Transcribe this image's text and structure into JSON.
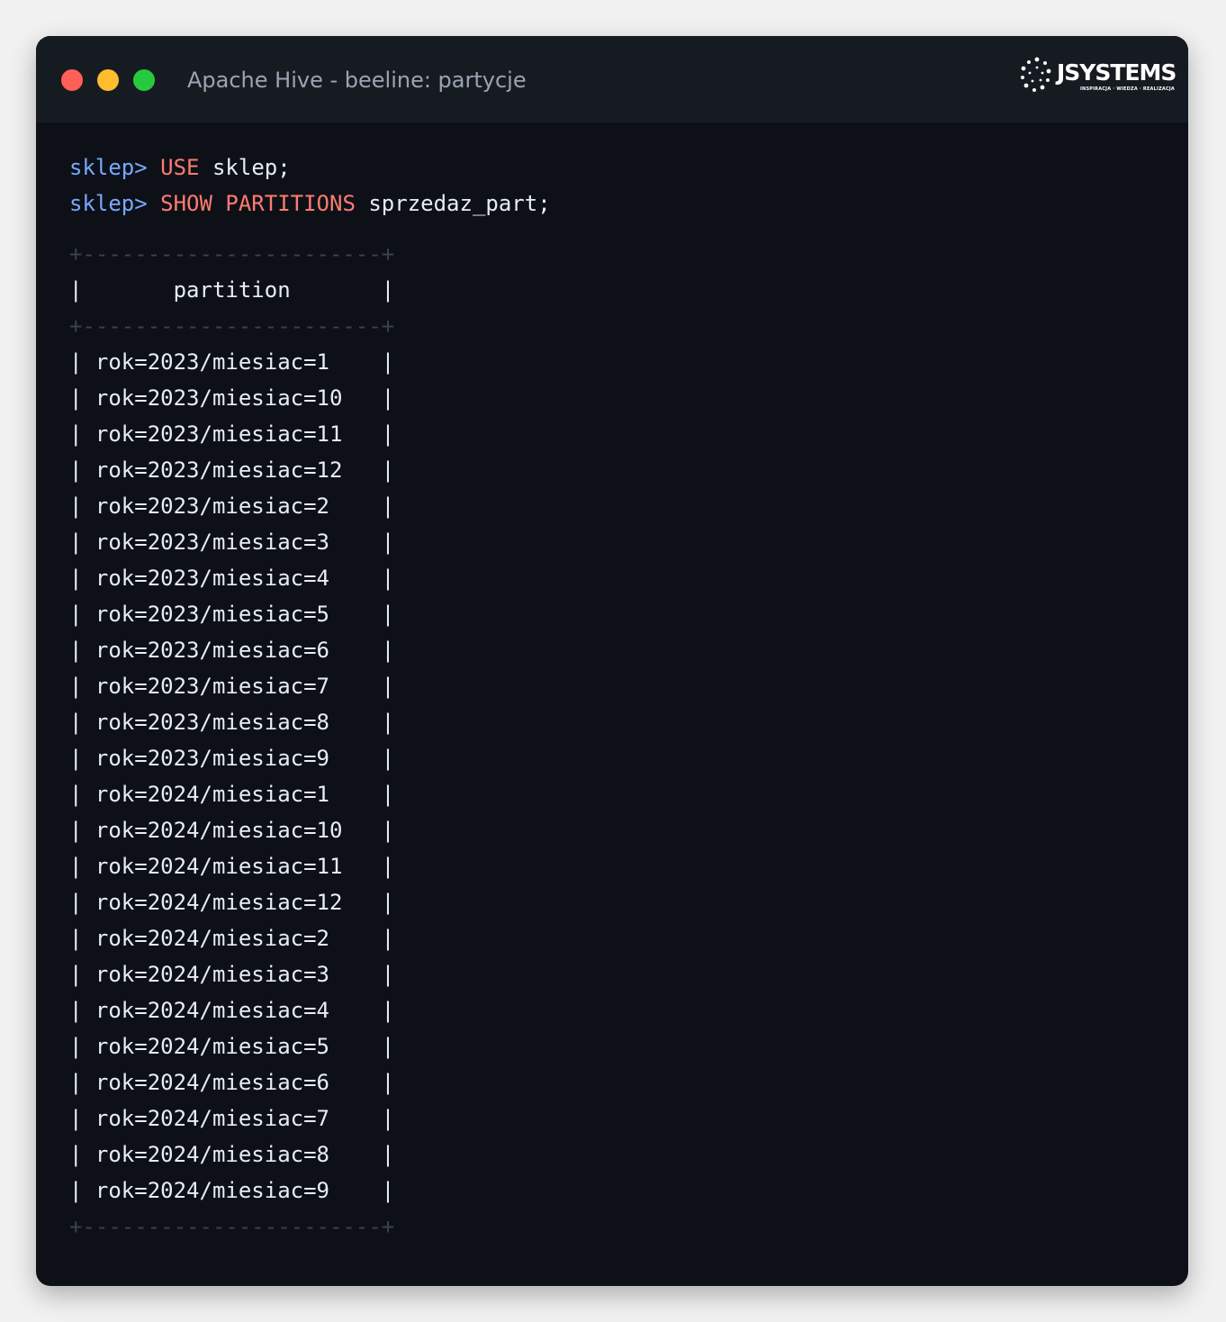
{
  "window": {
    "title": "Apache Hive - beeline: partycje",
    "logo": {
      "word": "JSYSTEMS",
      "tagline": "INSPIRACJA · WIEDZA · REALIZACJA"
    },
    "controls": {
      "close_color": "#ff5f56",
      "minimize_color": "#ffbd2e",
      "maximize_color": "#27c93f"
    }
  },
  "terminal": {
    "commands": [
      {
        "prompt": "sklep>",
        "keyword": "USE",
        "rest": "sklep;"
      },
      {
        "prompt": "sklep>",
        "keyword": "SHOW PARTITIONS",
        "rest": "sprzedaz_part;"
      }
    ],
    "table": {
      "border": "+-----------------------+",
      "header": "|       partition       |",
      "rows": [
        "| rok=2023/miesiac=1    |",
        "| rok=2023/miesiac=10   |",
        "| rok=2023/miesiac=11   |",
        "| rok=2023/miesiac=12   |",
        "| rok=2023/miesiac=2    |",
        "| rok=2023/miesiac=3    |",
        "| rok=2023/miesiac=4    |",
        "| rok=2023/miesiac=5    |",
        "| rok=2023/miesiac=6    |",
        "| rok=2023/miesiac=7    |",
        "| rok=2023/miesiac=8    |",
        "| rok=2023/miesiac=9    |",
        "| rok=2024/miesiac=1    |",
        "| rok=2024/miesiac=10   |",
        "| rok=2024/miesiac=11   |",
        "| rok=2024/miesiac=12   |",
        "| rok=2024/miesiac=2    |",
        "| rok=2024/miesiac=3    |",
        "| rok=2024/miesiac=4    |",
        "| rok=2024/miesiac=5    |",
        "| rok=2024/miesiac=6    |",
        "| rok=2024/miesiac=7    |",
        "| rok=2024/miesiac=8    |",
        "| rok=2024/miesiac=9    |"
      ]
    }
  },
  "colors": {
    "prompt": "#79a8ff",
    "keyword": "#ff7b72",
    "text": "#e6edf3",
    "border": "#3a414b",
    "background": "#0d1117"
  }
}
